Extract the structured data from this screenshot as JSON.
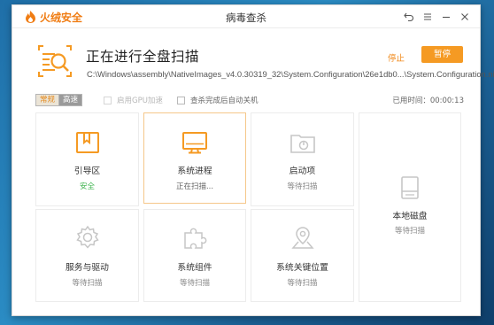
{
  "app": {
    "name": "火绒安全",
    "window_title": "病毒查杀"
  },
  "header": {
    "title": "正在进行全盘扫描",
    "current_path": "C:\\Windows\\assembly\\NativeImages_v4.0.30319_32\\System.Configuration\\26e1db0...\\System.Configuration.ni.dll",
    "stop_label": "停止",
    "pause_label": "暂停"
  },
  "options": {
    "modes": [
      "常规",
      "高速"
    ],
    "gpu_label": "启用GPU加速",
    "shutdown_label": "查杀完成后自动关机",
    "elapsed_label": "已用时间：00:00:13"
  },
  "tiles": [
    {
      "name": "引导区",
      "status": "安全",
      "icon": "bookmark-folder-icon",
      "state": "safe"
    },
    {
      "name": "系统进程",
      "status": "正在扫描...",
      "icon": "monitor-icon",
      "state": "scanning"
    },
    {
      "name": "启动项",
      "status": "等待扫描",
      "icon": "startup-folder-icon",
      "state": "waiting"
    },
    {
      "name": "本地磁盘",
      "status": "等待扫描",
      "icon": "hard-disk-icon",
      "state": "waiting"
    },
    {
      "name": "服务与驱动",
      "status": "等待扫描",
      "icon": "gear-icon",
      "state": "waiting"
    },
    {
      "name": "系统组件",
      "status": "等待扫描",
      "icon": "puzzle-icon",
      "state": "waiting"
    },
    {
      "name": "系统关键位置",
      "status": "等待扫描",
      "icon": "location-pin-icon",
      "state": "waiting"
    }
  ],
  "colors": {
    "accent": "#f59a23",
    "safe": "#3fb34f",
    "icon_inactive": "#c6c6c6"
  }
}
